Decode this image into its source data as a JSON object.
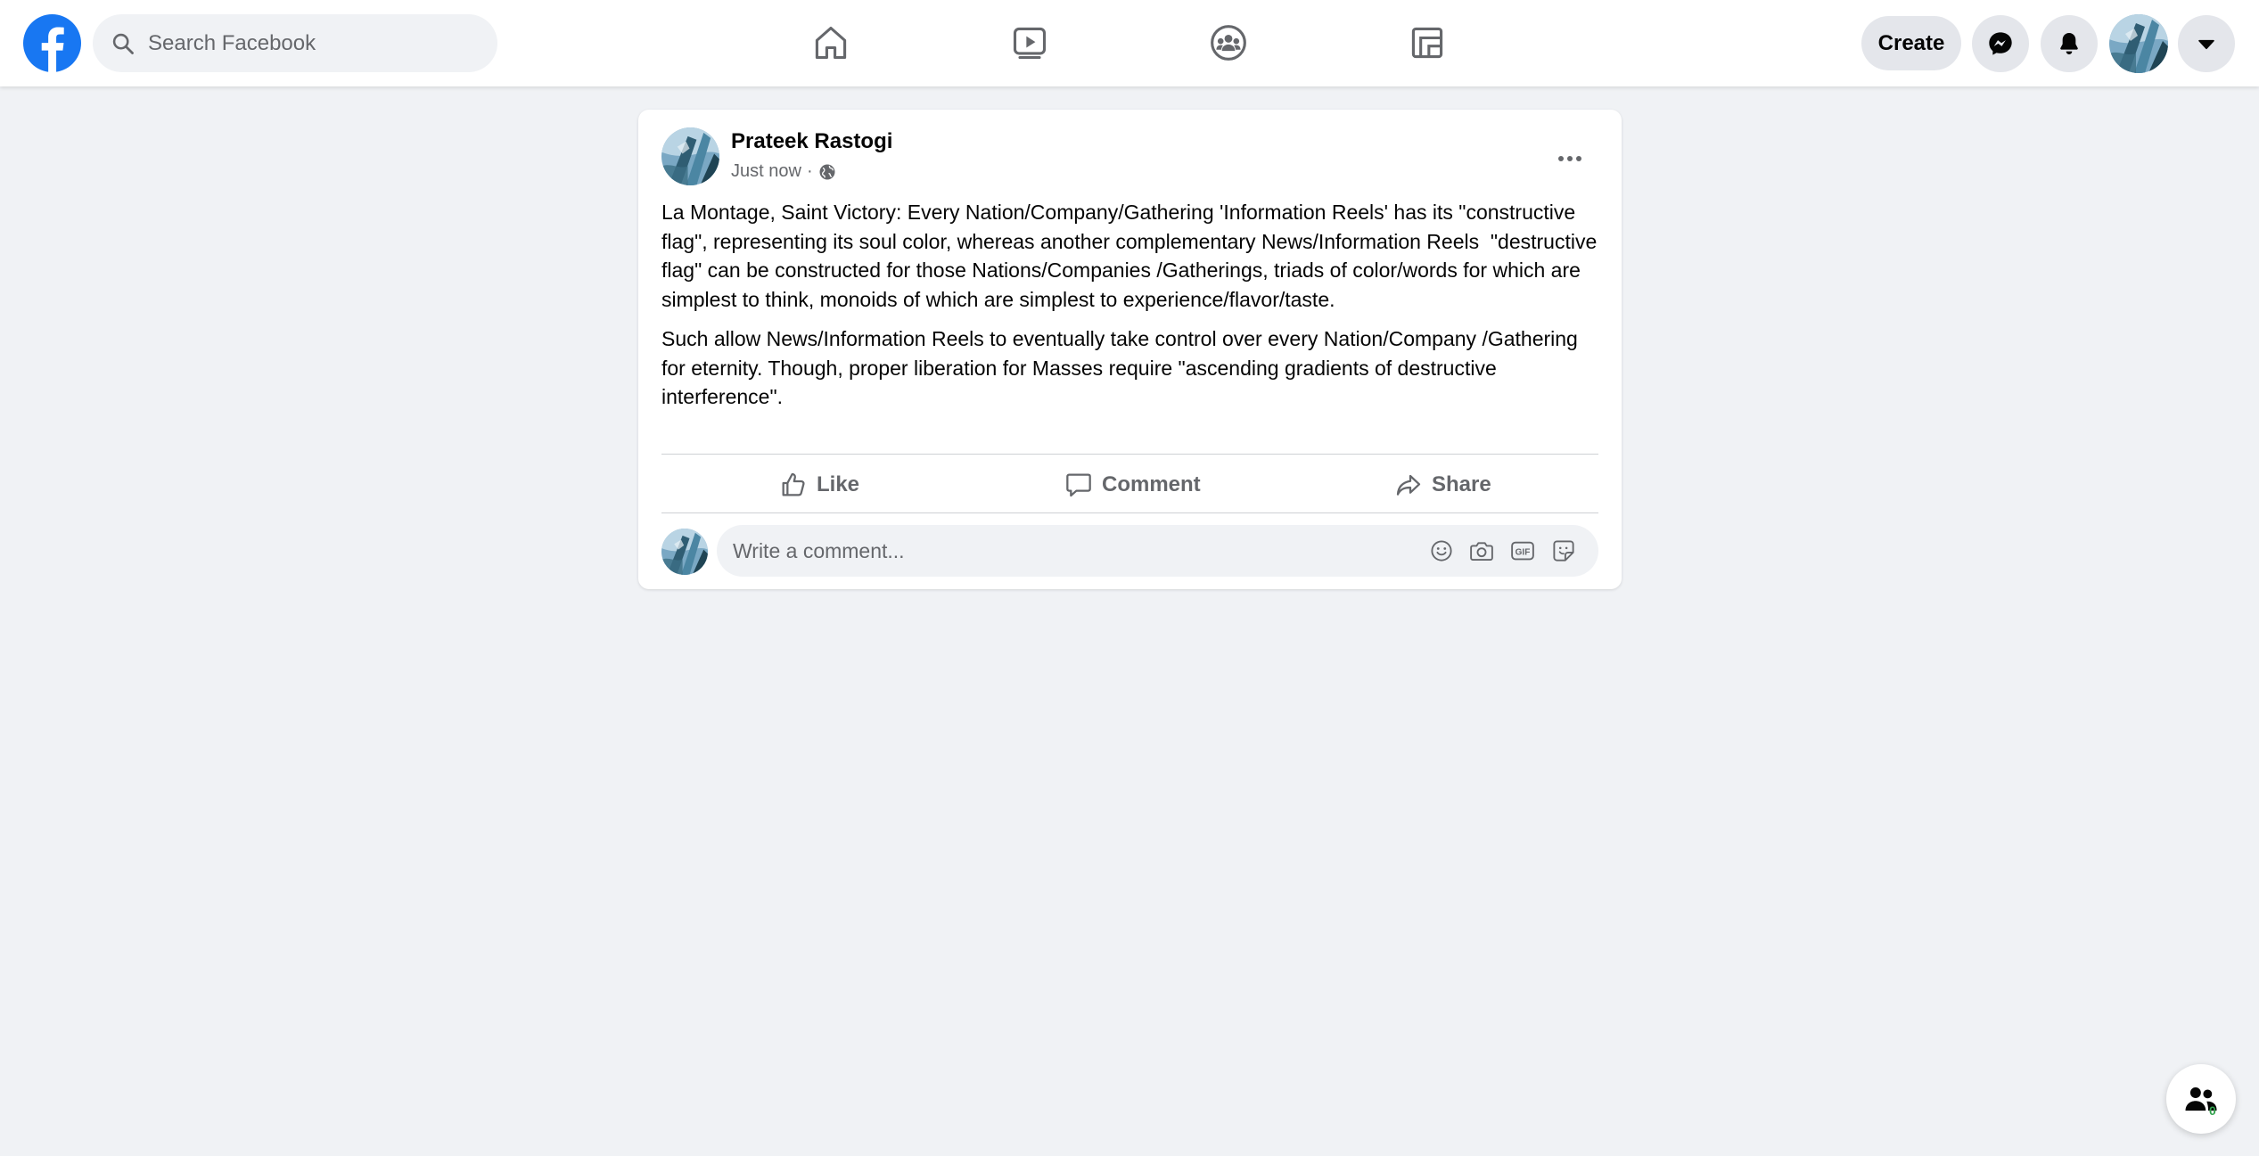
{
  "header": {
    "search_placeholder": "Search Facebook",
    "create_label": "Create",
    "icons": [
      "facebook-logo",
      "search-icon",
      "home-icon",
      "watch-icon",
      "groups-icon",
      "gaming-icon",
      "messenger-icon",
      "notifications-icon",
      "account-avatar",
      "caret-down-icon"
    ]
  },
  "post": {
    "author": "Prateek Rastogi",
    "timestamp": "Just now",
    "separator": "·",
    "audience_icon": "globe-icon",
    "paragraphs": [
      "La Montage, Saint Victory: Every Nation/Company/Gathering 'Information Reels' has its \"constructive flag\", representing its soul color, whereas another complementary News/Information Reels  \"destructive flag\" can be constructed for those Nations/Companies /Gatherings, triads of color/words for which are simplest to think, monoids of which are simplest to experience/flavor/taste.",
      "Such allow News/Information Reels to eventually take control over every Nation/Company /Gathering for eternity. Though, proper liberation for Masses require \"ascending gradients of destructive interference\"."
    ],
    "actions": {
      "like": "Like",
      "comment": "Comment",
      "share": "Share"
    },
    "comment_placeholder": "Write a comment..."
  },
  "contacts": {
    "count": "0"
  },
  "colors": {
    "brand_blue": "#1877f2",
    "background": "#f0f2f5",
    "secondary_text": "#65676b",
    "online_green": "#31a24c"
  }
}
